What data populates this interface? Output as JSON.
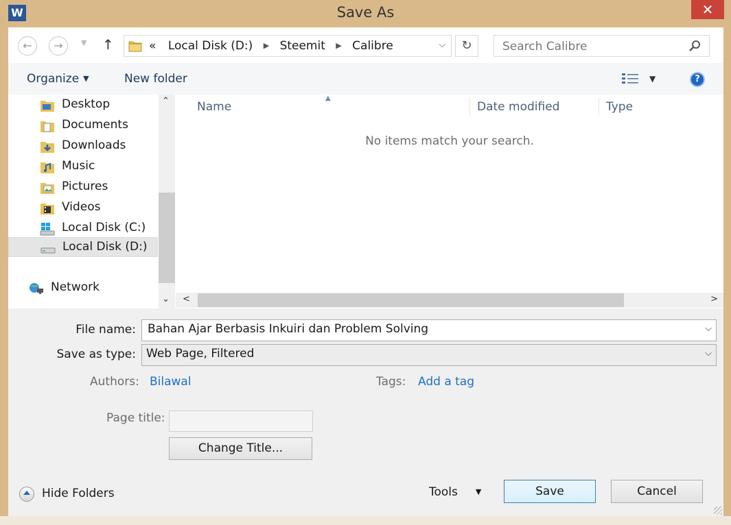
{
  "window": {
    "title": "Save As",
    "close_glyph": "✕",
    "app_icon": "W"
  },
  "nav": {
    "back_icon": "back-arrow-icon",
    "forward_icon": "forward-arrow-icon",
    "up_icon": "up-arrow-icon",
    "address": {
      "overflow": "«",
      "crumbs": [
        "Local Disk (D:)",
        "Steemit",
        "Calibre"
      ],
      "separator": "▶",
      "dropdown": "⌵"
    },
    "refresh_glyph": "↻",
    "search_placeholder": "Search Calibre"
  },
  "toolbar": {
    "organize": "Organize",
    "new_folder": "New folder"
  },
  "sidebar": {
    "items": [
      {
        "label": "Desktop",
        "icon": "desktop-folder-icon"
      },
      {
        "label": "Documents",
        "icon": "documents-folder-icon"
      },
      {
        "label": "Downloads",
        "icon": "downloads-folder-icon"
      },
      {
        "label": "Music",
        "icon": "music-folder-icon"
      },
      {
        "label": "Pictures",
        "icon": "pictures-folder-icon"
      },
      {
        "label": "Videos",
        "icon": "videos-folder-icon"
      },
      {
        "label": "Local Disk (C:)",
        "icon": "windows-drive-icon"
      },
      {
        "label": "Local Disk (D:)",
        "icon": "drive-icon",
        "selected": true
      }
    ],
    "network": {
      "label": "Network",
      "icon": "network-icon"
    }
  },
  "filelist": {
    "columns": [
      "Name",
      "Date modified",
      "Type"
    ],
    "empty_message": "No items match your search."
  },
  "form": {
    "file_name_label": "File name:",
    "file_name_value": "Bahan Ajar Berbasis Inkuiri dan Problem Solving",
    "save_as_type_label": "Save as type:",
    "save_as_type_value": "Web Page, Filtered",
    "authors_label": "Authors:",
    "authors_value": "Bilawal",
    "tags_label": "Tags:",
    "tags_value": "Add a tag",
    "page_title_label": "Page title:",
    "change_title_button": "Change Title..."
  },
  "footer": {
    "hide_folders": "Hide Folders",
    "tools": "Tools",
    "save": "Save",
    "cancel": "Cancel"
  },
  "colors": {
    "frame": "#d9b98a",
    "close": "#c94339",
    "link": "#1e6fc5",
    "help": "#1f64c7"
  }
}
